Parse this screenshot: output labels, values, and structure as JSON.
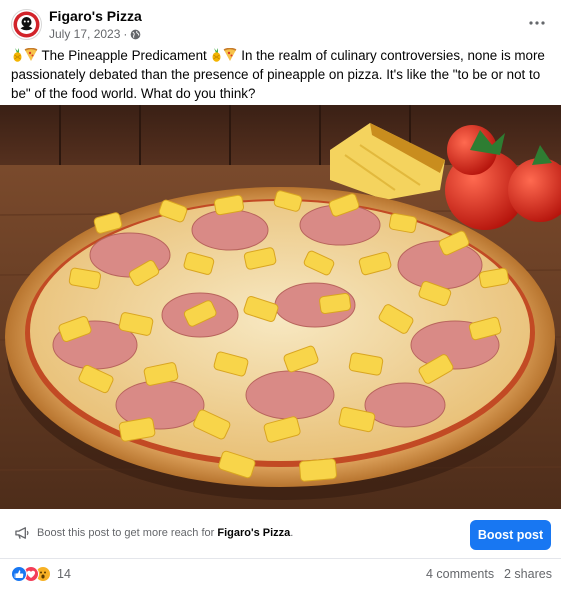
{
  "post": {
    "page_name": "Figaro's Pizza",
    "date": "July 17, 2023",
    "separator": "·",
    "text_title": "The Pineapple Predicament",
    "text_body": "In the realm of culinary controversies, none is more passionately debated than the presence of pineapple on pizza. It's like the \"to be or not to be\" of the food world. What do you think?",
    "emoji_pair": [
      "pineapple-emoji",
      "pizza-emoji"
    ]
  },
  "boost": {
    "message_prefix": "Boost this post to get more reach for",
    "page_name": "Figaro's Pizza",
    "message_suffix": ".",
    "button_label": "Boost post"
  },
  "engagement": {
    "reaction_types": [
      "like",
      "love",
      "wow"
    ],
    "reaction_count": "14",
    "comments": "4 comments",
    "shares": "2 shares"
  },
  "icons": {
    "more": "more-options-icon",
    "audience": "globe-icon",
    "boost": "megaphone-icon"
  },
  "colors": {
    "brand_blue": "#1877f2",
    "secondary_text": "#65676b",
    "primary_text": "#050505",
    "logo_red": "#d2232a"
  }
}
